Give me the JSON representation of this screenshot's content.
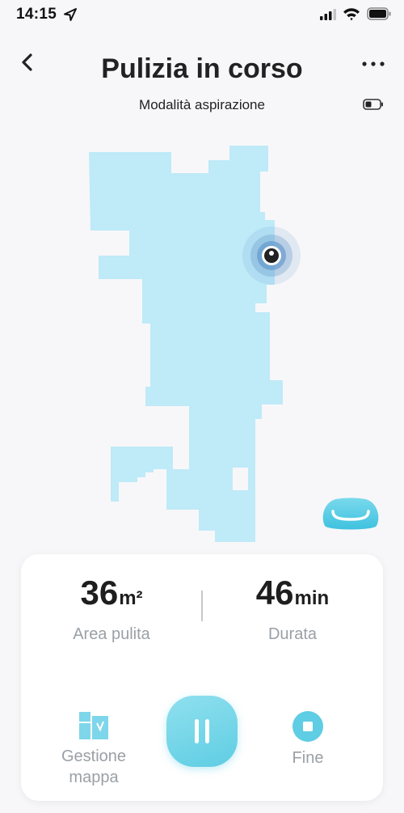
{
  "status_bar": {
    "time": "14:15",
    "location_icon": "location-arrow-icon",
    "signal_icon": "cellular-signal-icon",
    "wifi_icon": "wifi-icon",
    "battery_icon": "battery-icon"
  },
  "header": {
    "title": "Pulizia in corso",
    "subtitle": "Modalità aspirazione",
    "back_icon": "chevron-left-icon",
    "more_icon": "more-dots-icon",
    "robot_battery_icon": "robot-battery-icon"
  },
  "map": {
    "fill_color": "#bfeaf8",
    "robot_color": "#5b93c8",
    "robot_icon": "robot-position-icon",
    "dock_icon": "dock-station-icon",
    "dock_color": "#55cde6"
  },
  "stats": {
    "area_value": "36",
    "area_unit": "m²",
    "area_label": "Area pulita",
    "duration_value": "46",
    "duration_unit": "min",
    "duration_label": "Durata"
  },
  "actions": {
    "map_label": "Gestione mappa",
    "map_icon": "map-management-icon",
    "pause_icon": "pause-icon",
    "stop_label": "Fine",
    "stop_icon": "stop-icon",
    "accent": "#5fcde3",
    "disabled_color": "#9aa0a6"
  }
}
